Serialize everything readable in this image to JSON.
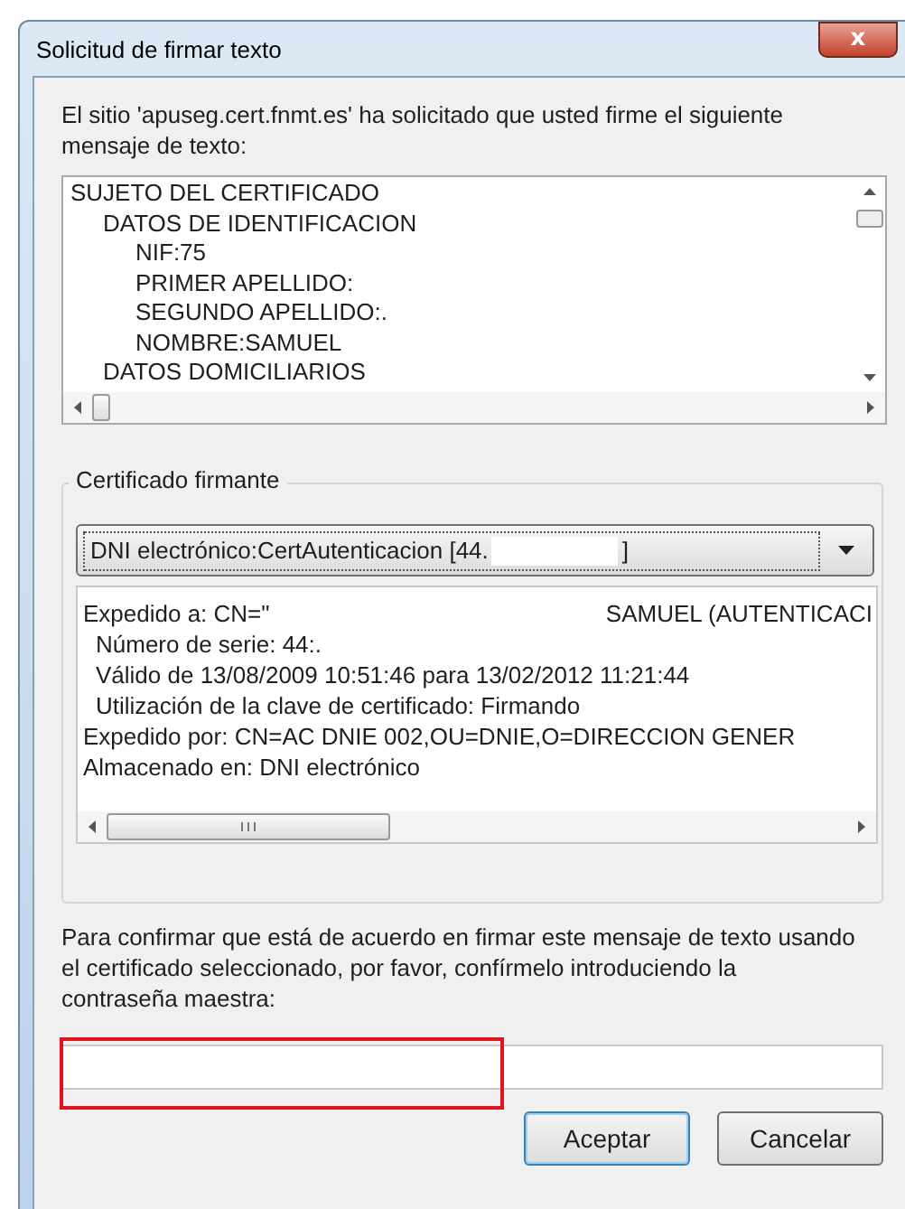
{
  "window": {
    "title": "Solicitud de firmar texto",
    "close_label": "x"
  },
  "intro": "El sitio 'apuseg.cert.fnmt.es' ha solicitado que usted firme el siguiente mensaje de texto:",
  "message": [
    {
      "text": "SUJETO DEL CERTIFICADO",
      "children": [
        {
          "text": "DATOS DE IDENTIFICACION",
          "children": [
            {
              "text": "NIF:75"
            },
            {
              "text": "PRIMER APELLIDO:"
            },
            {
              "text": "SEGUNDO APELLIDO:."
            },
            {
              "text": "NOMBRE:SAMUEL"
            }
          ]
        },
        {
          "text": "DATOS DOMICILIARIOS"
        }
      ]
    }
  ],
  "certificate_group": {
    "label": "Certificado firmante",
    "dropdown": {
      "value": "DNI electrónico:CertAutenticacion [44.",
      "value_end": "]"
    },
    "details": [
      {
        "text": "Expedido a: CN=\"",
        "text_end": "SAMUEL (AUTENTICACI",
        "children": [
          {
            "text": "Número de serie: 44:."
          },
          {
            "text": "Válido de 13/08/2009 10:51:46 para 13/02/2012 11:21:44"
          },
          {
            "text": "Utilización de la clave de certificado: Firmando"
          }
        ]
      },
      {
        "text": "Expedido por: CN=AC DNIE 002,OU=DNIE,O=DIRECCION GENER"
      },
      {
        "text": "Almacenado en: DNI electrónico"
      }
    ]
  },
  "confirm_text": "Para confirmar que está de acuerdo en firmar este mensaje de texto usando el certificado seleccionado, por favor, confírmelo introduciendo la contraseña maestra:",
  "password": {
    "highlighted": true
  },
  "buttons": [
    {
      "label": "Aceptar",
      "default": true
    },
    {
      "label": "Cancelar",
      "default": false
    }
  ]
}
